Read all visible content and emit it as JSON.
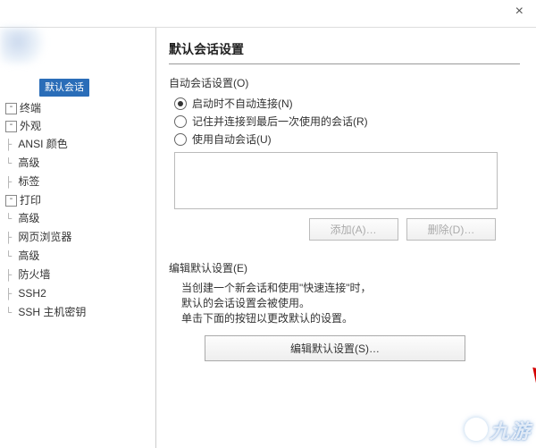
{
  "titlebar": {
    "close": "×"
  },
  "tree": {
    "selected_badge": "默认会话",
    "terminal": "终端",
    "appearance": "外观",
    "ansi_colors": "ANSI 颜色",
    "advanced1": "高级",
    "tabs": "标签",
    "printing": "打印",
    "advanced2": "高级",
    "web_browser": "网页浏览器",
    "advanced3": "高级",
    "firewall": "防火墙",
    "ssh2": "SSH2",
    "ssh_host_keys": "SSH 主机密钥"
  },
  "panel": {
    "title": "默认会话设置",
    "auto_group_label": "自动会话设置(O)",
    "radio_no_connect": "启动时不自动连接(N)",
    "radio_remember": "记住并连接到最后一次使用的会话(R)",
    "radio_use_auto": "使用自动会话(U)",
    "radio_selected": "no_connect",
    "btn_add": "添加(A)…",
    "btn_delete": "删除(D)…",
    "edit_group_label": "编辑默认设置(E)",
    "desc_line1": "当创建一个新会话和使用\"快速连接\"时，",
    "desc_line2": "默认的会话设置会被使用。",
    "desc_line3": "单击下面的按钮以更改默认的设置。",
    "btn_edit_defaults": "编辑默认设置(S)…"
  },
  "watermark": "九游"
}
